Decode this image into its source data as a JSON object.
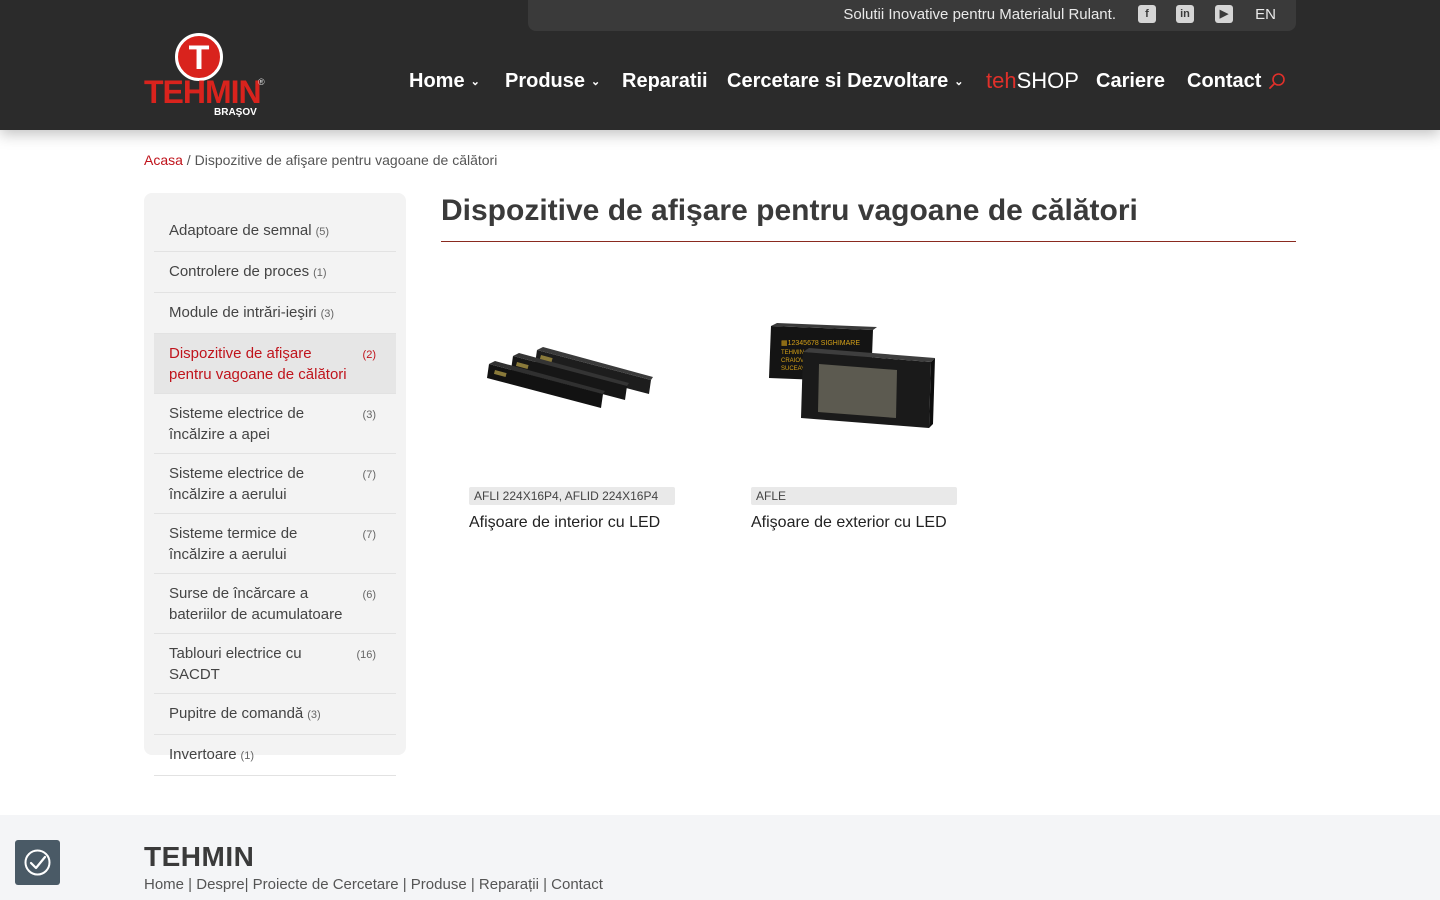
{
  "header": {
    "tagline": "Solutii Inovative pentru Materialul Rulant.",
    "social": [
      {
        "name": "facebook-icon",
        "glyph": "f"
      },
      {
        "name": "linkedin-icon",
        "glyph": "in"
      },
      {
        "name": "youtube-icon",
        "glyph": "▶"
      }
    ],
    "lang": "EN",
    "logo": {
      "letter": "T",
      "wordmark": "TEHMIN",
      "reg": "®",
      "city": "BRAŞOV"
    },
    "nav": [
      {
        "label": "Home",
        "dropdown": true
      },
      {
        "label": "Produse",
        "dropdown": true
      },
      {
        "label": "Reparatii",
        "dropdown": false
      },
      {
        "label": "Cercetare si Dezvoltare",
        "dropdown": true
      }
    ],
    "shop": {
      "prefix": "teh",
      "suffix": "SHOP"
    },
    "nav_after": [
      {
        "label": "Cariere"
      },
      {
        "label": "Contact"
      }
    ],
    "accent_color": "#e0302a"
  },
  "breadcrumb": {
    "home": "Acasa",
    "separator": " / ",
    "current": "Dispozitive de afişare pentru vagoane de călători"
  },
  "sidebar": {
    "categories": [
      {
        "label": "Adaptoare de semnal",
        "count": "(5)",
        "active": false
      },
      {
        "label": "Controlere de proces",
        "count": "(1)",
        "active": false
      },
      {
        "label": "Module de intrări-ieşiri",
        "count": "(3)",
        "active": false
      },
      {
        "label": "Dispozitive de afişare pentru vagoane de călători",
        "count": "(2)",
        "active": true
      },
      {
        "label": "Sisteme electrice de încălzire a apei",
        "count": "(3)",
        "active": false
      },
      {
        "label": "Sisteme electrice de încălzire a aerului",
        "count": "(7)",
        "active": false
      },
      {
        "label": "Sisteme termice de încălzire a aerului",
        "count": "(7)",
        "active": false
      },
      {
        "label": "Surse de încărcare a bateriilor de acumulatoare",
        "count": "(6)",
        "active": false
      },
      {
        "label": "Tablouri electrice cu SACDT",
        "count": "(16)",
        "active": false
      },
      {
        "label": "Pupitre de comandă",
        "count": "(3)",
        "active": false
      },
      {
        "label": "Invertoare",
        "count": "(1)",
        "active": false
      }
    ]
  },
  "main": {
    "title": "Dispozitive de afişare pentru vagoane de călători",
    "products": [
      {
        "sku": "AFLI 224X16P4, AFLID 224X16P4",
        "name": "Afişoare de interior cu LED"
      },
      {
        "sku": "AFLE",
        "name": "Afişoare de exterior cu LED",
        "screen_text": [
          "▦12345678 SIGHIMARE",
          "TEHMIN S",
          "CRAIOVA",
          "SUCEAVA"
        ]
      }
    ]
  },
  "footer": {
    "brand": "TEHMIN",
    "links": "Home | Despre| Proiecte de Cercetare | Produse | Reparații | Contact"
  }
}
